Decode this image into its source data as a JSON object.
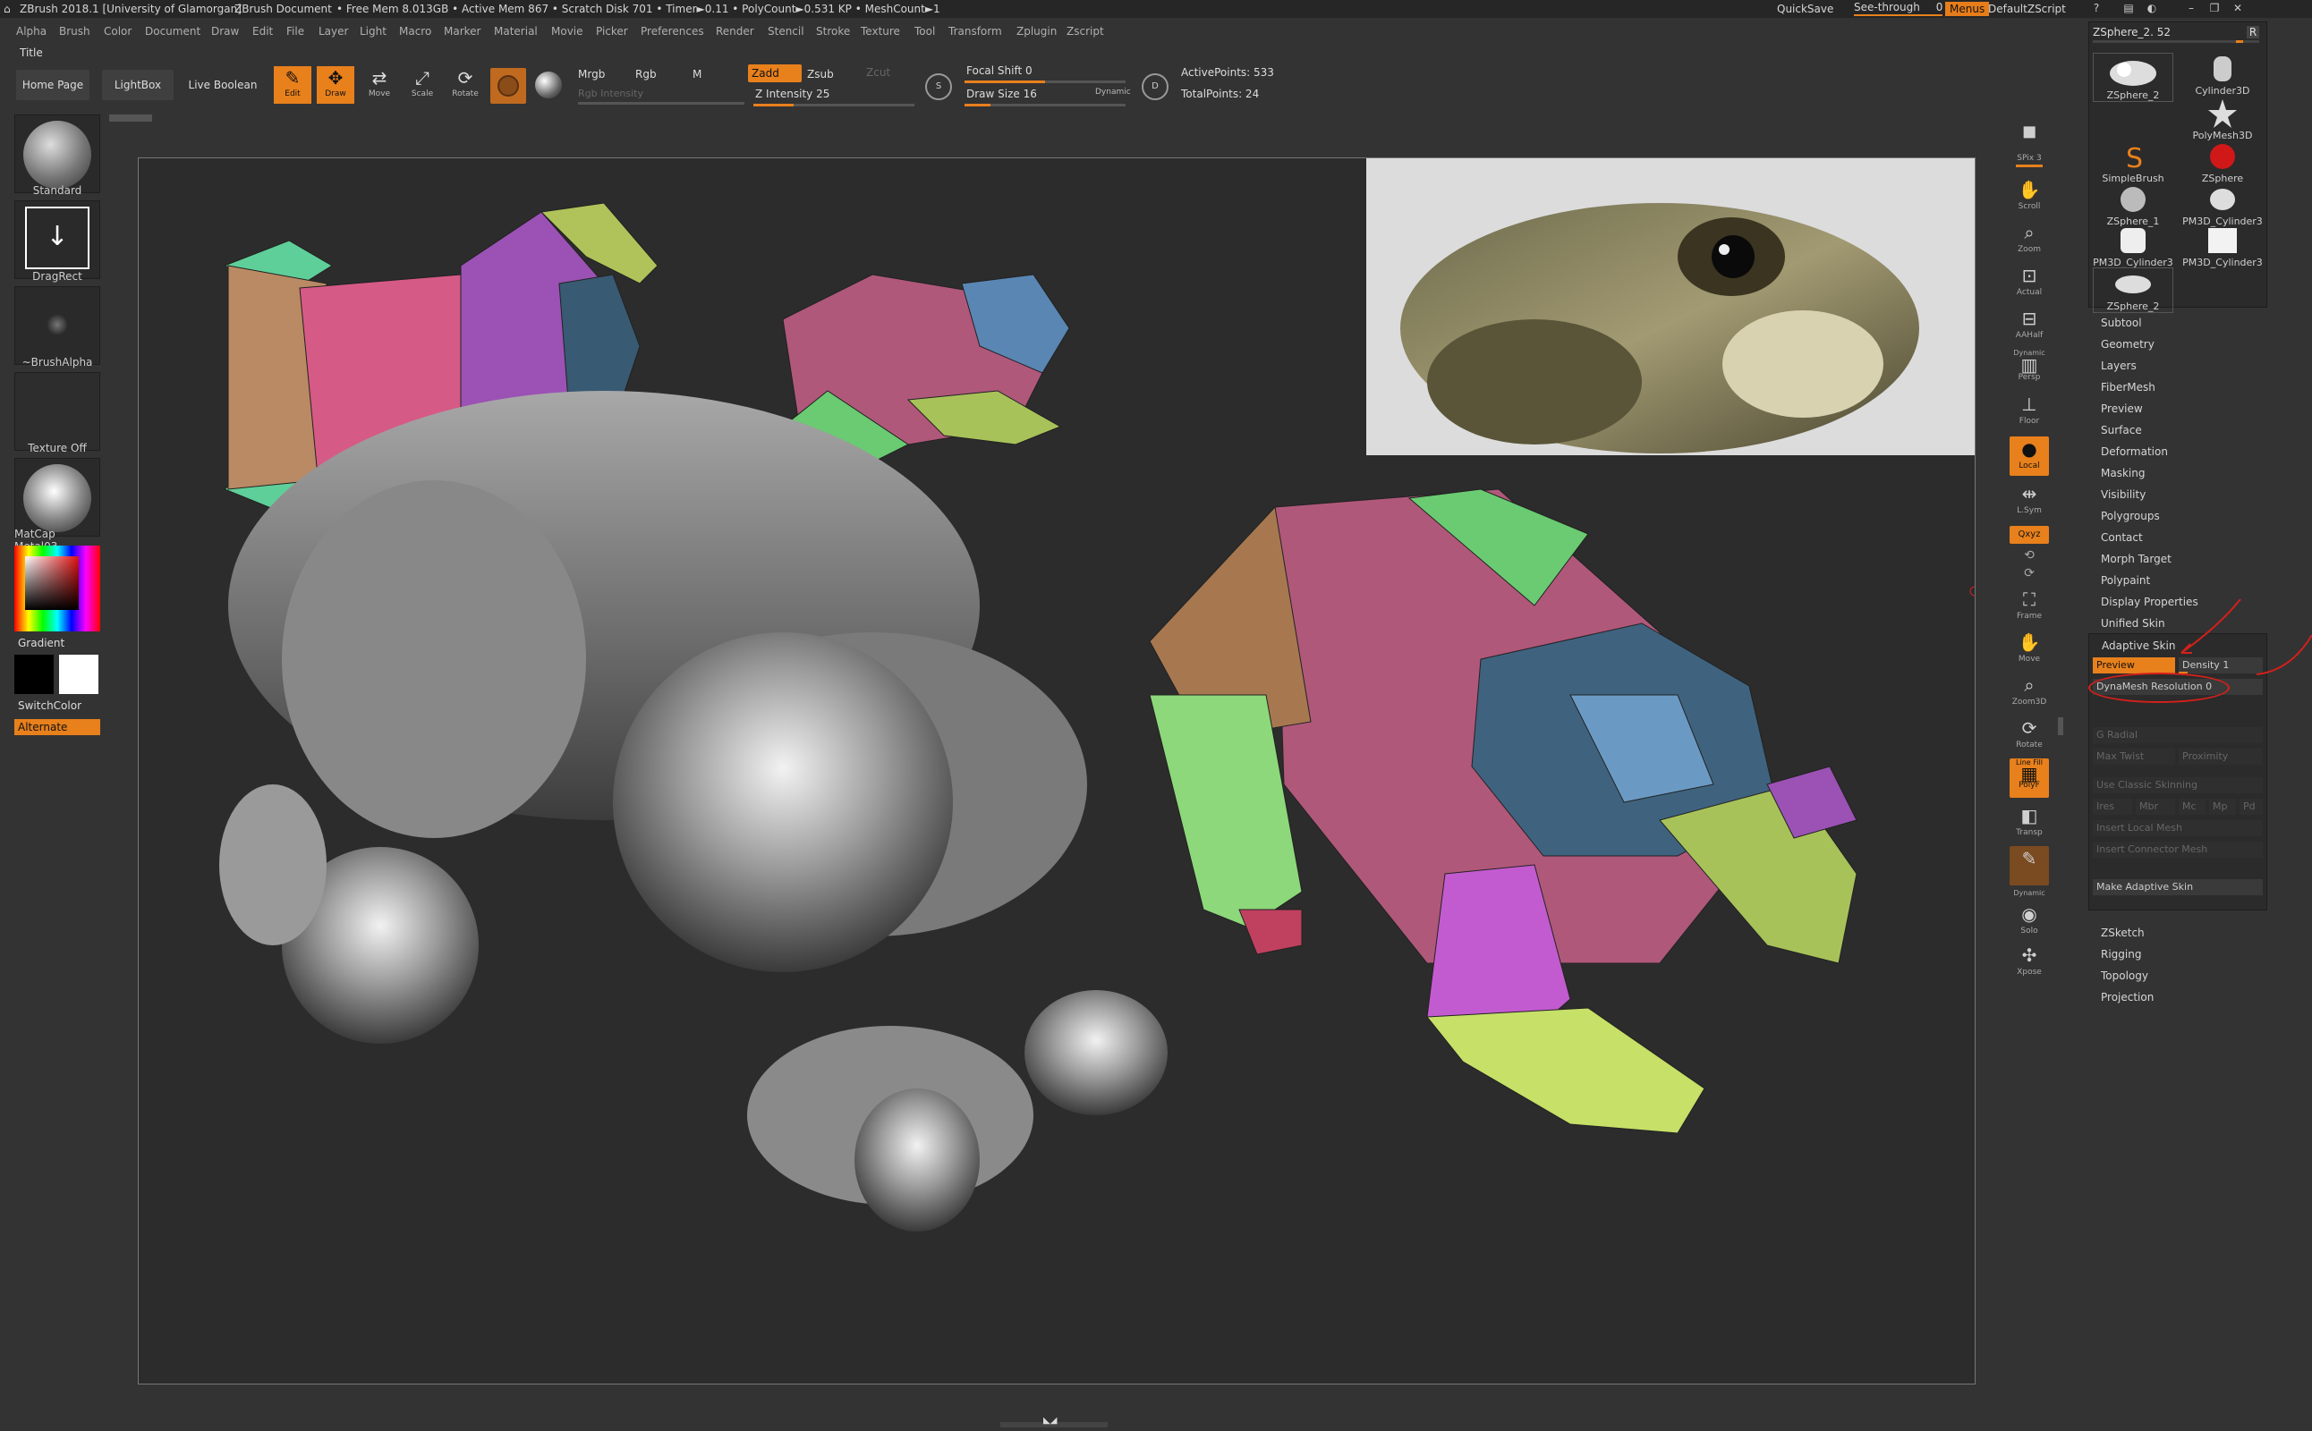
{
  "titlebar": {
    "app": "ZBrush 2018.1 [University of Glamorgan]",
    "doc": "ZBrush Document",
    "stats": "• Free Mem 8.013GB • Active Mem 867 • Scratch Disk 701 • Timer►0.11 • PolyCount►0.531 KP • MeshCount►1",
    "quicksave": "QuickSave",
    "seethrough": "See-through",
    "seethrough_val": "0",
    "menus": "Menus",
    "defaultscript": "DefaultZScript"
  },
  "menus": [
    "Alpha",
    "Brush",
    "Color",
    "Document",
    "Draw",
    "Edit",
    "File",
    "Layer",
    "Light",
    "Macro",
    "Marker",
    "Material",
    "Movie",
    "Picker",
    "Preferences",
    "Render",
    "Stencil",
    "Stroke",
    "Texture",
    "Tool",
    "Transform",
    "Zplugin",
    "Zscript"
  ],
  "title_label": "Title",
  "toolbar": {
    "home": "Home Page",
    "lightbox": "LightBox",
    "liveboolean": "Live Boolean",
    "edit": "Edit",
    "draw": "Draw",
    "move": "Move",
    "scale": "Scale",
    "rotate": "Rotate",
    "mrgb": "Mrgb",
    "rgb": "Rgb",
    "m": "M",
    "rgb_intensity": "Rgb Intensity",
    "zadd": "Zadd",
    "zsub": "Zsub",
    "zcut": "Zcut",
    "z_intensity": "Z Intensity 25",
    "focal_shift": "Focal Shift 0",
    "draw_size": "Draw Size 16",
    "dynamic": "Dynamic",
    "s": "S",
    "d": "D",
    "active_points": "ActivePoints: 533",
    "total_points": "TotalPoints: 24"
  },
  "progress": {
    "z_intensity": 0.25,
    "focal_shift": 0.5,
    "draw_size": 0.16
  },
  "left": {
    "standard": "Standard",
    "dragrect": "DragRect",
    "brushalpha": "~BrushAlpha",
    "texture": "Texture Off",
    "matcap": "MatCap Metal03",
    "gradient": "Gradient",
    "switchcolor": "SwitchColor",
    "alternate": "Alternate"
  },
  "right": {
    "spix_label": "SPix",
    "spix_val": "3",
    "scroll": "Scroll",
    "zoom": "Zoom",
    "actual": "Actual",
    "aahalf": "AAHalf",
    "dynamic": "Dynamic",
    "persp": "Persp",
    "floor": "Floor",
    "local": "Local",
    "lsym": "L.Sym",
    "xyz": "Qxyz",
    "frame": "Frame",
    "move": "Move",
    "zoom3d": "Zoom3D",
    "rotate": "Rotate",
    "linefill": "Line Fill",
    "polyf": "PolyF",
    "transp": "Transp",
    "dynamic2": "Dynamic",
    "solo": "Solo",
    "xpose": "Xpose"
  },
  "tool_palette": {
    "current": "ZSphere_2. 52",
    "r": "R",
    "items": [
      "ZSphere_2",
      "Cylinder3D",
      "PolyMesh3D",
      "SimpleBrush",
      "ZSphere",
      "ZSphere_1",
      "PM3D_Cylinder3",
      "PM3D_Cylinder3",
      "PM3D_Cylinder3",
      "ZSphere_2"
    ]
  },
  "tool_menu": {
    "items_top": [
      "Subtool",
      "Geometry",
      "Layers",
      "FiberMesh",
      "Preview",
      "Surface",
      "Deformation",
      "Masking",
      "Visibility",
      "Polygroups",
      "Contact",
      "Morph Target",
      "Polypaint",
      "Display Properties",
      "Unified Skin"
    ],
    "adaptive_skin": "Adaptive Skin",
    "preview": "Preview",
    "density": "Density 1",
    "dynamesh": "DynaMesh Resolution 0",
    "g_radial": "G Radial",
    "max_twist": "Max Twist",
    "proximity": "Proximity",
    "use_classic": "Use Classic Skinning",
    "ires": "Ires",
    "mbr": "Mbr",
    "mc": "Mc",
    "mp": "Mp",
    "pd": "Pd",
    "insert_local": "Insert Local Mesh",
    "insert_connector": "Insert Connector Mesh",
    "make_adaptive": "Make Adaptive Skin",
    "items_bottom": [
      "ZSketch",
      "Rigging",
      "Topology",
      "Projection"
    ]
  },
  "colors": {
    "accent": "#e8801c",
    "panel": "#2b2b2b",
    "bg": "#333333",
    "annotation": "#d4201a"
  }
}
